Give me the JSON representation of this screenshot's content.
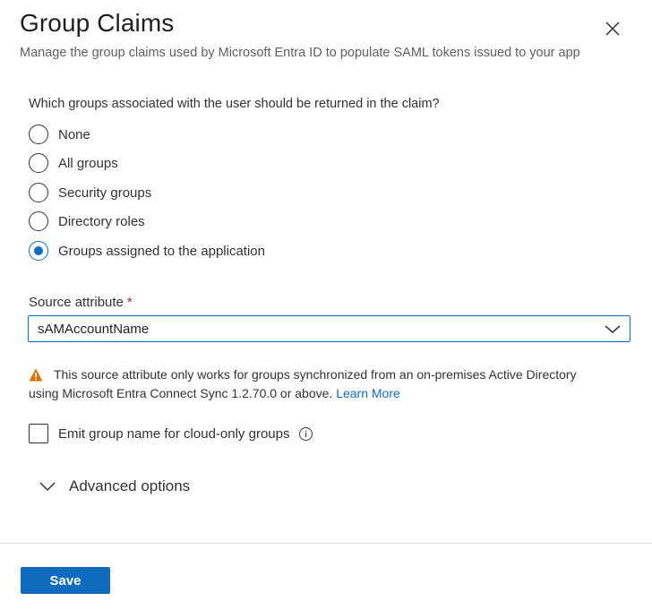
{
  "header": {
    "title": "Group Claims",
    "subtitle": "Manage the group claims used by Microsoft Entra ID to populate SAML tokens issued to your app",
    "close_icon": "close-icon"
  },
  "groups_question": "Which groups associated with the user should be returned in the claim?",
  "radio_options": [
    {
      "label": "None",
      "checked": false
    },
    {
      "label": "All groups",
      "checked": false
    },
    {
      "label": "Security groups",
      "checked": false
    },
    {
      "label": "Directory roles",
      "checked": false
    },
    {
      "label": "Groups assigned to the application",
      "checked": true
    }
  ],
  "source_attribute": {
    "label": "Source attribute",
    "required_mark": "*",
    "selected_value": "sAMAccountName"
  },
  "warning": {
    "icon": "warning-icon",
    "text_line1": "This source attribute only works for groups synchronized from an on-premises Active Directory",
    "text_line2": "using Microsoft Entra Connect Sync 1.2.70.0 or above.",
    "link_text": "Learn More"
  },
  "emit_checkbox": {
    "label": "Emit group name for cloud-only groups",
    "checked": false,
    "info_icon": "info-icon"
  },
  "advanced": {
    "label": "Advanced options",
    "expanded": false
  },
  "footer": {
    "save_label": "Save"
  },
  "colors": {
    "accent": "#0f6cbd",
    "warning": "#d47500",
    "required": "#a4262c"
  }
}
